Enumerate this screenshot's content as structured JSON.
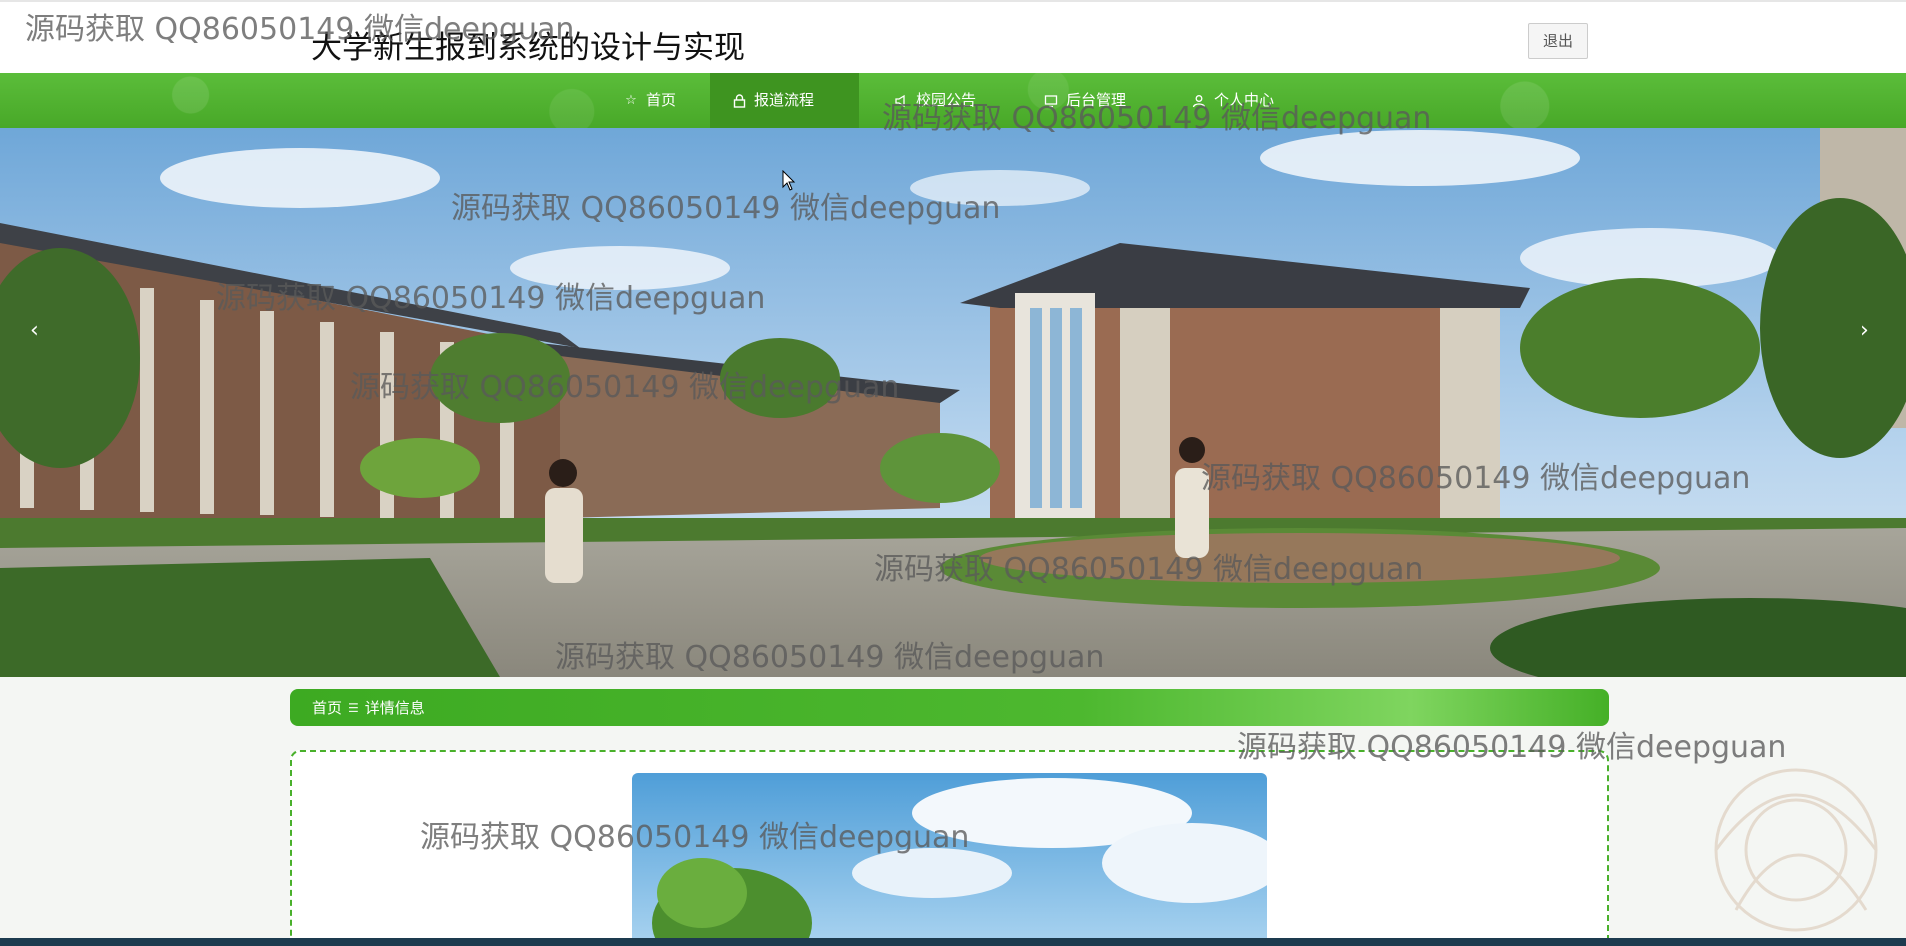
{
  "header": {
    "site_title": "大学新生报到系统的设计与实现",
    "logout_label": "退出"
  },
  "nav": {
    "items": [
      {
        "label": "首页",
        "icon": "star-icon"
      },
      {
        "label": "报道流程",
        "icon": "lock-icon"
      },
      {
        "label": "校园公告",
        "icon": "megaphone-icon"
      },
      {
        "label": "后台管理",
        "icon": "monitor-icon"
      },
      {
        "label": "个人中心",
        "icon": "user-icon"
      }
    ],
    "active_index": 1
  },
  "banner": {
    "prev_arrow": "‹",
    "next_arrow": "›"
  },
  "breadcrumb": {
    "home": "首页",
    "separator": "☰",
    "current": "详情信息"
  },
  "watermark_text": "源码获取 QQ86050149 微信deepguan",
  "colors": {
    "nav_green": "#4db52e",
    "active_green": "#3e9420",
    "panel_border": "#49b02b"
  }
}
